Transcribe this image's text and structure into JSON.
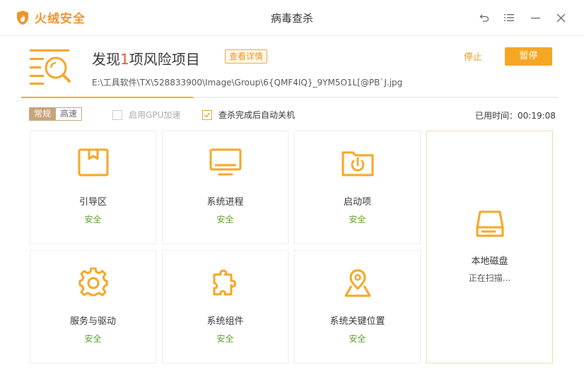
{
  "app": {
    "brand": "火绒安全",
    "window_title": "病毒查杀"
  },
  "header": {
    "title_prefix": "发现",
    "title_count": "1",
    "title_suffix": "项风险项目",
    "detail_button": "查看详情",
    "scan_path": "E:\\工具软件\\TX\\528833900\\Image\\Group\\6{QMF4IQ}_9YM5O1L[@PB`J.jpg",
    "stop_label": "停止",
    "pause_label": "暂停",
    "progress_fraction": 0.32
  },
  "options": {
    "modes": [
      "常规",
      "高速"
    ],
    "active_mode": "常规",
    "gpu_label": "启用GPU加速",
    "gpu_checked": false,
    "shutdown_label": "查杀完成后自动关机",
    "shutdown_checked": true,
    "elapsed": "已用时间：00:19:08"
  },
  "items": [
    {
      "icon": "boot-sector-icon",
      "label": "引导区",
      "status": "安全"
    },
    {
      "icon": "monitor-icon",
      "label": "系统进程",
      "status": "安全"
    },
    {
      "icon": "startup-folder-icon",
      "label": "启动项",
      "status": "安全"
    },
    {
      "icon": "gear-icon",
      "label": "服务与驱动",
      "status": "安全"
    },
    {
      "icon": "puzzle-icon",
      "label": "系统组件",
      "status": "安全"
    },
    {
      "icon": "location-pin-icon",
      "label": "系统关键位置",
      "status": "安全"
    },
    {
      "icon": "hard-disk-icon",
      "label": "本地磁盘",
      "status": "正在扫描..."
    }
  ],
  "colors": {
    "accent": "#f5a623",
    "safe": "#5a9e2a",
    "risk_number": "#e8532a",
    "brand": "#f0932b"
  }
}
